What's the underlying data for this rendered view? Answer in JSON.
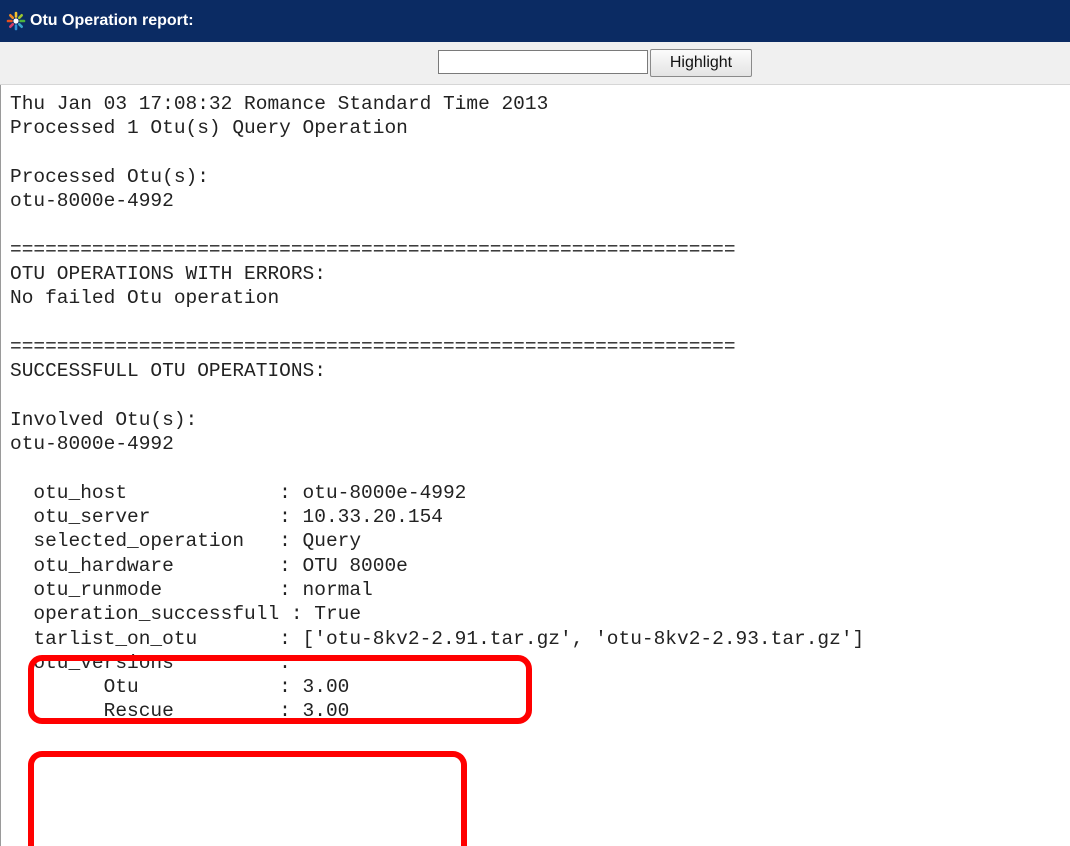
{
  "window": {
    "title": "Otu Operation report:",
    "icon": "gear-icon"
  },
  "toolbar": {
    "search_value": "",
    "highlight_label": "Highlight"
  },
  "report": {
    "lines": [
      "Thu Jan 03 17:08:32 Romance Standard Time 2013",
      "Processed 1 Otu(s) Query Operation",
      "",
      "Processed Otu(s):",
      "otu-8000e-4992",
      "",
      "==============================================================",
      "OTU OPERATIONS WITH ERRORS:",
      "No failed Otu operation",
      "",
      "==============================================================",
      "SUCCESSFULL OTU OPERATIONS:",
      "",
      "Involved Otu(s):",
      "otu-8000e-4992",
      "",
      "  otu_host             : otu-8000e-4992",
      "  otu_server           : 10.33.20.154",
      "  selected_operation   : Query",
      "  otu_hardware         : OTU 8000e",
      "  otu_runmode          : normal",
      "  operation_successfull : True",
      "  tarlist_on_otu       : ['otu-8kv2-2.91.tar.gz', 'otu-8kv2-2.93.tar.gz']",
      "  otu_versions         :",
      "        Otu            : 3.00",
      "        Rescue         : 3.00"
    ]
  },
  "colors": {
    "titlebar": "#0b2b63",
    "annotation": "#ff0000"
  }
}
